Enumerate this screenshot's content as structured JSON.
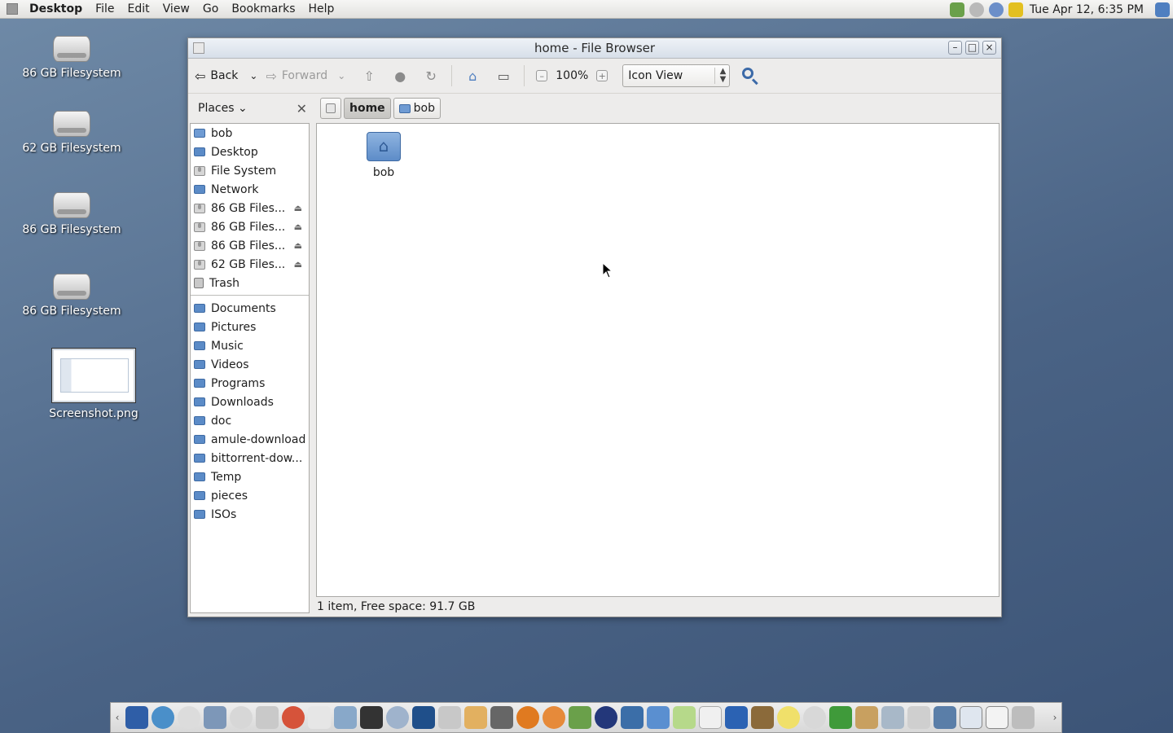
{
  "top_panel": {
    "menus": [
      "Desktop",
      "File",
      "Edit",
      "View",
      "Go",
      "Bookmarks",
      "Help"
    ],
    "clock": "Tue Apr 12,  6:35 PM"
  },
  "desktop_icons": [
    {
      "label": "86 GB Filesystem",
      "type": "drive"
    },
    {
      "label": "62 GB Filesystem",
      "type": "drive"
    },
    {
      "label": "86 GB Filesystem",
      "type": "drive"
    },
    {
      "label": "86 GB Filesystem",
      "type": "drive"
    },
    {
      "label": "Screenshot.png",
      "type": "image"
    }
  ],
  "window": {
    "title": "home - File Browser",
    "toolbar": {
      "back": "Back",
      "forward": "Forward",
      "zoom": "100%",
      "view_mode": "Icon View"
    },
    "sidebar_title": "Places",
    "places": [
      {
        "label": "bob",
        "icon": "home-icon"
      },
      {
        "label": "Desktop",
        "icon": "desktop-icon"
      },
      {
        "label": "File System",
        "icon": "filesystem-icon"
      },
      {
        "label": "Network",
        "icon": "network-icon"
      },
      {
        "label": "86 GB Files...",
        "icon": "drive-icon",
        "eject": true
      },
      {
        "label": "86 GB Files...",
        "icon": "drive-icon",
        "eject": true
      },
      {
        "label": "86 GB Files...",
        "icon": "drive-icon",
        "eject": true
      },
      {
        "label": "62 GB Files...",
        "icon": "drive-icon",
        "eject": true
      },
      {
        "label": "Trash",
        "icon": "trash-icon"
      }
    ],
    "bookmarks": [
      "Documents",
      "Pictures",
      "Music",
      "Videos",
      "Programs",
      "Downloads",
      "doc",
      "amule-download",
      "bittorrent-dow...",
      "Temp",
      "pieces",
      "ISOs"
    ],
    "path": [
      "home",
      "bob"
    ],
    "files": [
      {
        "label": "bob"
      }
    ],
    "status": "1 item, Free space: 91.7 GB"
  },
  "colors": {
    "desktop_bg": "#4a6385",
    "folder_blue": "#5b8bc7"
  }
}
